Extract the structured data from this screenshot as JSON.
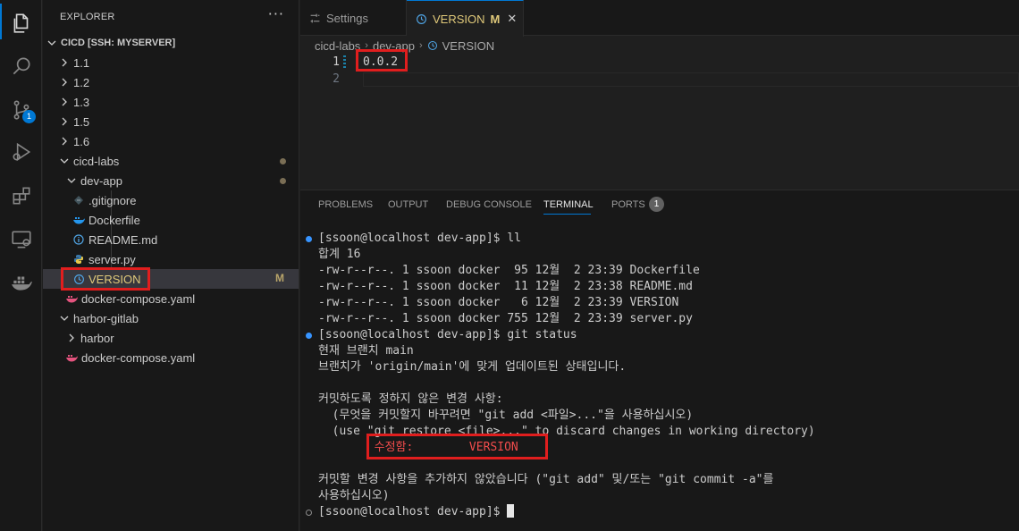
{
  "activity_bar": {
    "items": [
      {
        "name": "explorer-icon"
      },
      {
        "name": "search-icon"
      },
      {
        "name": "source-control-icon",
        "badge": "1"
      },
      {
        "name": "run-debug-icon"
      },
      {
        "name": "extensions-icon"
      },
      {
        "name": "remote-explorer-icon"
      },
      {
        "name": "docker-icon"
      }
    ]
  },
  "sidebar": {
    "title": "EXPLORER",
    "more": "···",
    "root": "CICD [SSH: MYSERVER]",
    "items": [
      {
        "label": "1.1",
        "kind": "folder"
      },
      {
        "label": "1.2",
        "kind": "folder"
      },
      {
        "label": "1.3",
        "kind": "folder"
      },
      {
        "label": "1.5",
        "kind": "folder"
      },
      {
        "label": "1.6",
        "kind": "folder"
      },
      {
        "label": "cicd-labs",
        "kind": "folder-open"
      },
      {
        "label": "dev-app",
        "kind": "folder-open"
      },
      {
        "label": ".gitignore",
        "kind": "file",
        "icon": "gitignore-icon"
      },
      {
        "label": "Dockerfile",
        "kind": "file",
        "icon": "docker-file-icon"
      },
      {
        "label": "README.md",
        "kind": "file",
        "icon": "info-icon"
      },
      {
        "label": "server.py",
        "kind": "file",
        "icon": "python-icon"
      },
      {
        "label": "VERSION",
        "kind": "file",
        "icon": "version-file-icon",
        "status": "M"
      },
      {
        "label": "docker-compose.yaml",
        "kind": "file",
        "icon": "docker-compose-icon"
      },
      {
        "label": "harbor-gitlab",
        "kind": "folder-open"
      },
      {
        "label": "harbor",
        "kind": "folder"
      },
      {
        "label": "docker-compose.yaml",
        "kind": "file",
        "icon": "docker-compose-icon"
      }
    ]
  },
  "tabs": [
    {
      "label": "Settings"
    },
    {
      "label": "VERSION",
      "status": "M",
      "close": "✕"
    }
  ],
  "breadcrumb": [
    "cicd-labs",
    "dev-app",
    "VERSION"
  ],
  "editor": {
    "lines": [
      {
        "num": "1",
        "text": "0.0.2"
      },
      {
        "num": "2",
        "text": ""
      }
    ]
  },
  "panel": {
    "tabs": [
      "PROBLEMS",
      "OUTPUT",
      "DEBUG CONSOLE",
      "TERMINAL",
      "PORTS"
    ],
    "ports_badge": "1",
    "terminal": [
      "[ssoon@localhost dev-app]$ ll",
      "합계 16",
      "-rw-r--r--. 1 ssoon docker  95 12월  2 23:39 Dockerfile",
      "-rw-r--r--. 1 ssoon docker  11 12월  2 23:38 README.md",
      "-rw-r--r--. 1 ssoon docker   6 12월  2 23:39 VERSION",
      "-rw-r--r--. 1 ssoon docker 755 12월  2 23:39 server.py",
      "[ssoon@localhost dev-app]$ git status",
      "현재 브랜치 main",
      "브랜치가 'origin/main'에 맞게 업데이트된 상태입니다.",
      "",
      "커밋하도록 정하지 않은 변경 사항:",
      "  (무엇을 커밋할지 바꾸려면 \"git add <파일>...\"을 사용하십시오)",
      "  (use \"git restore <file>...\" to discard changes in working directory)",
      "        수정함:        VERSION",
      "",
      "커밋할 변경 사항을 추가하지 않았습니다 (\"git add\" 및/또는 \"git commit -a\"를",
      "사용하십시오)",
      "[ssoon@localhost dev-app]$ "
    ]
  },
  "colors": {
    "accent": "#0078d4",
    "highlight_box": "#e01e1e",
    "modified": "#e0c97a",
    "terminal_red": "#f14c4c"
  }
}
